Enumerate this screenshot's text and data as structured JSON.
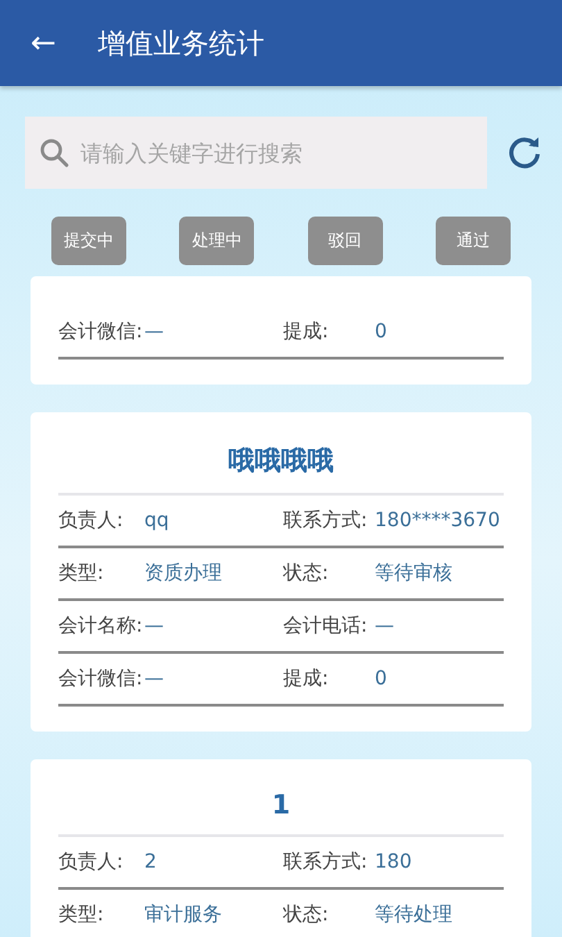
{
  "header": {
    "back": "←",
    "title": "增值业务统计"
  },
  "search": {
    "placeholder": "请输入关键字进行搜索"
  },
  "filters": [
    {
      "label": "提交中"
    },
    {
      "label": "处理中"
    },
    {
      "label": "驳回"
    },
    {
      "label": "通过"
    }
  ],
  "cards": [
    {
      "rows": [
        [
          {
            "label": "会计微信:",
            "value": "—"
          },
          {
            "label": "提成:",
            "value": "0"
          }
        ]
      ]
    },
    {
      "title": "哦哦哦哦",
      "rows": [
        [
          {
            "label": "负责人:",
            "value": "qq"
          },
          {
            "label": "联系方式:",
            "value": "180****3670"
          }
        ],
        [
          {
            "label": "类型:",
            "value": "资质办理"
          },
          {
            "label": "状态:",
            "value": "等待审核"
          }
        ],
        [
          {
            "label": "会计名称:",
            "value": "—"
          },
          {
            "label": "会计电话:",
            "value": "—"
          }
        ],
        [
          {
            "label": "会计微信:",
            "value": "—"
          },
          {
            "label": "提成:",
            "value": "0"
          }
        ]
      ]
    },
    {
      "title": "1",
      "rows": [
        [
          {
            "label": "负责人:",
            "value": "2"
          },
          {
            "label": "联系方式:",
            "value": "180"
          }
        ],
        [
          {
            "label": "类型:",
            "value": "审计服务"
          },
          {
            "label": "状态:",
            "value": "等待处理"
          }
        ]
      ]
    }
  ]
}
